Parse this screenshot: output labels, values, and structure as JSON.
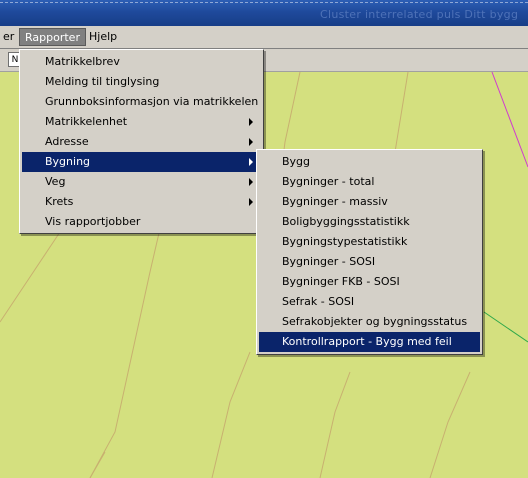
{
  "titlebar": {
    "ghost_text": "Cluster   interrelated  puls    Ditt bygg"
  },
  "menubar": {
    "items": [
      {
        "label": "er"
      },
      {
        "label": "Rapporter"
      },
      {
        "label": "Hjelp"
      }
    ]
  },
  "toolbar": {
    "button_label": "N"
  },
  "colors": {
    "map_background": "#d4e07f",
    "menu_highlight": "#0a246a",
    "menu_face": "#d4d0c8"
  },
  "rapporter_menu": {
    "items": [
      {
        "label": "Matrikkelbrev"
      },
      {
        "label": "Melding til tinglysing"
      },
      {
        "label": "Grunnboksinformasjon via matrikkelen"
      },
      {
        "label": "Matrikkelenhet"
      },
      {
        "label": "Adresse"
      },
      {
        "label": "Bygning"
      },
      {
        "label": "Veg"
      },
      {
        "label": "Krets"
      },
      {
        "label": "Vis rapportjobber"
      }
    ]
  },
  "bygning_submenu": {
    "items": [
      {
        "label": "Bygg"
      },
      {
        "label": "Bygninger - total"
      },
      {
        "label": "Bygninger - massiv"
      },
      {
        "label": "Boligbyggingsstatistikk"
      },
      {
        "label": "Bygningstypestatistikk"
      },
      {
        "label": "Bygninger - SOSI"
      },
      {
        "label": "Bygninger FKB - SOSI"
      },
      {
        "label": "Sefrak - SOSI"
      },
      {
        "label": "Sefrakobjekter og bygningsstatus"
      },
      {
        "label": "Kontrollrapport - Bygg med feil"
      }
    ]
  }
}
